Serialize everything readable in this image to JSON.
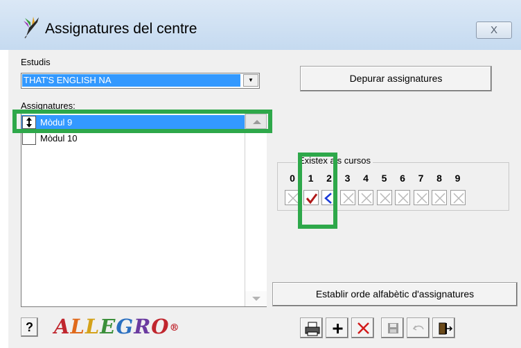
{
  "window": {
    "title": "Assignatures del centre",
    "close_glyph": "X",
    "app_icon": "hummingbird-icon"
  },
  "estudis": {
    "label": "Estudis",
    "selected": "THAT'S ENGLISH NA"
  },
  "buttons": {
    "depurar": "Depurar assignatures",
    "establir": "Establir orde alfabètic d'assignatures",
    "help": "?"
  },
  "assignatures": {
    "label": "Assignatures:",
    "items": [
      {
        "label": "Mòdul 9",
        "selected": true,
        "marker": "up-down-arrows"
      },
      {
        "label": "Mòdul 10",
        "selected": false,
        "marker": ""
      }
    ]
  },
  "cursos": {
    "title": "Existex als cursos",
    "numbers": [
      "0",
      "1",
      "2",
      "3",
      "4",
      "5",
      "6",
      "7",
      "8",
      "9"
    ],
    "states": [
      "disabled",
      "checked",
      "unchecked",
      "disabled",
      "disabled",
      "disabled",
      "disabled",
      "disabled",
      "disabled",
      "disabled"
    ]
  },
  "logo": {
    "text": "ALLEGRO",
    "mark": "®"
  },
  "toolbar": [
    "print-icon",
    "add-icon",
    "delete-icon",
    "save-icon",
    "undo-icon",
    "exit-icon"
  ],
  "colors": {
    "selection": "#3399ff",
    "highlight": "#2ea84a",
    "check": "#b01818",
    "cross_active": "#1a3ad8"
  }
}
